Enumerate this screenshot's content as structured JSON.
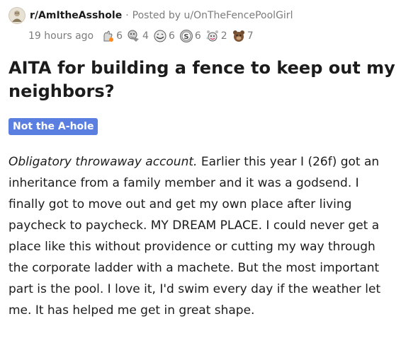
{
  "post": {
    "subreddit": "r/AmItheAsshole",
    "separator": "·",
    "posted_by": "Posted by u/OnTheFencePoolGirl",
    "time_ago": "19 hours ago",
    "awards": [
      {
        "icon": "wholesome-award-icon",
        "count": "6"
      },
      {
        "icon": "gold-award-icon",
        "count": "4"
      },
      {
        "icon": "laughing-award-icon",
        "count": "6"
      },
      {
        "icon": "silver-award-icon",
        "count": "6"
      },
      {
        "icon": "helpful-award-icon",
        "count": "2"
      },
      {
        "icon": "bear-award-icon",
        "count": "7"
      }
    ],
    "title": "AITA for building a fence to keep out my neighbors?",
    "flair": "Not the A-hole",
    "body_italic": "Obligatory throwaway account.",
    "body_rest": " Earlier this year I (26f) got an inheritance from a family member and it was a godsend. I finally got to move out and get my own place after living paycheck to paycheck. MY DREAM PLACE. I could never get a place like this without providence or cutting my way through the corporate ladder with a machete. But the most important part is the pool. I love it, I'd swim every day if the weather let me. It has helped me get in great shape."
  },
  "colors": {
    "flair_bg": "#5b7fe0",
    "meta_text": "#7c7c7c",
    "text": "#1c1c1c"
  }
}
